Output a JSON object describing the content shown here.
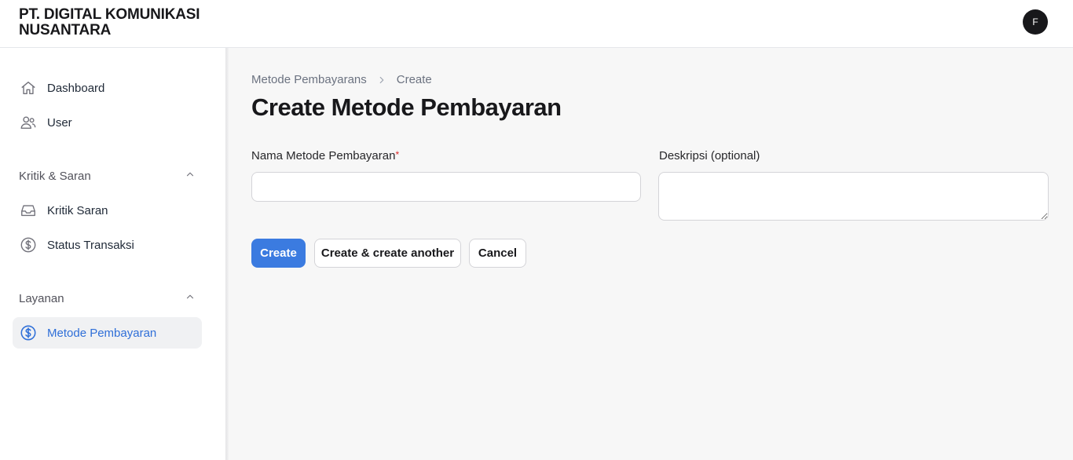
{
  "header": {
    "brand": "PT. DIGITAL KOMUNIKASI NUSANTARA",
    "avatar_initial": "F"
  },
  "sidebar": {
    "items": [
      {
        "label": "Dashboard",
        "icon": "home-icon"
      },
      {
        "label": "User",
        "icon": "users-icon"
      }
    ],
    "groups": [
      {
        "label": "Kritik & Saran",
        "items": [
          {
            "label": "Kritik Saran",
            "icon": "inbox-icon"
          },
          {
            "label": "Status Transaksi",
            "icon": "dollar-circle-icon"
          }
        ]
      },
      {
        "label": "Layanan",
        "items": [
          {
            "label": "Metode Pembayaran",
            "icon": "dollar-circle-icon",
            "active": true
          }
        ]
      }
    ]
  },
  "breadcrumb": {
    "parent": "Metode Pembayarans",
    "current": "Create"
  },
  "page": {
    "title": "Create Metode Pembayaran"
  },
  "form": {
    "name_label": "Nama Metode Pembayaran",
    "name_required_mark": "*",
    "name_value": "",
    "description_label": "Deskripsi (optional)",
    "description_value": ""
  },
  "actions": {
    "create": "Create",
    "create_another": "Create & create another",
    "cancel": "Cancel"
  },
  "colors": {
    "primary": "#3b7be0",
    "active_nav_text": "#2f6fd8",
    "required": "#dc2626"
  }
}
